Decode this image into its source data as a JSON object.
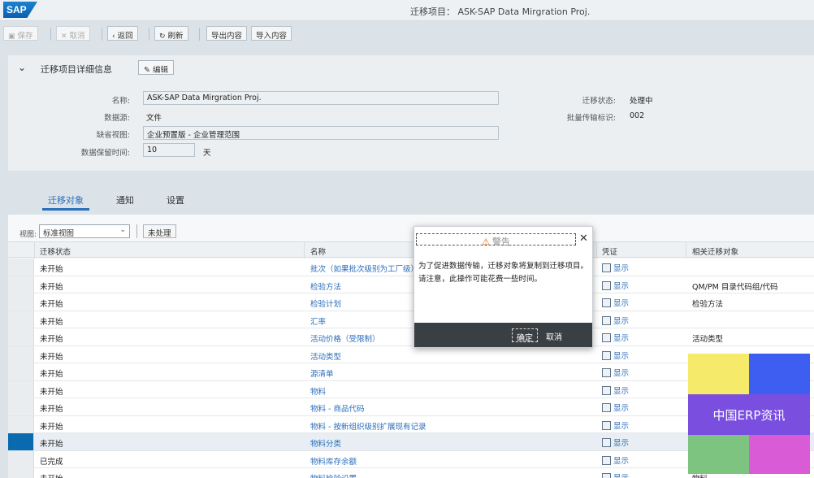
{
  "header": {
    "logo": "SAP",
    "title": "迁移项目：   ASK-SAP Data Mirgration Proj."
  },
  "toolbar": {
    "save": "保存",
    "cancel": "取消",
    "back": "返回",
    "refresh": "刷新",
    "export": "导出内容",
    "import": "导入内容"
  },
  "details": {
    "title": "迁移项目详细信息",
    "edit": "编辑",
    "name_label": "名称:",
    "name_value": "ASK-SAP Data Mirgration Proj.",
    "source_label": "数据源:",
    "source_value": "文件",
    "view_label": "缺省视图:",
    "view_value": "企业预置版 - 企业管理范围",
    "retention_label": "数据保留时间:",
    "retention_value": "10",
    "retention_unit": "天",
    "status_label": "迁移状态:",
    "status_value": "处理中",
    "batch_label": "批量传输标识:",
    "batch_value": "002"
  },
  "tabs": [
    {
      "label": "迁移对象"
    },
    {
      "label": "通知"
    },
    {
      "label": "设置"
    }
  ],
  "table": {
    "view_label": "视图:",
    "view_selected": "标准视图",
    "unprocessed": "未处理",
    "columns": [
      "迁移状态",
      "名称",
      "凭证",
      "相关迁移对象"
    ],
    "rows": [
      {
        "status": "未开始",
        "name": "批次（如果批次级别为工厂级）",
        "doc": "显示",
        "rel": ""
      },
      {
        "status": "未开始",
        "name": "检验方法",
        "doc": "显示",
        "rel": "QM/PM 目录代码组/代码"
      },
      {
        "status": "未开始",
        "name": "检验计划",
        "doc": "显示",
        "rel": "检验方法"
      },
      {
        "status": "未开始",
        "name": "汇率",
        "doc": "显示",
        "rel": ""
      },
      {
        "status": "未开始",
        "name": "活动价格（受限制）",
        "doc": "显示",
        "rel": "活动类型"
      },
      {
        "status": "未开始",
        "name": "活动类型",
        "doc": "显示",
        "rel": ""
      },
      {
        "status": "未开始",
        "name": "源清单",
        "doc": "显示",
        "rel": ""
      },
      {
        "status": "未开始",
        "name": "物料",
        "doc": "显示",
        "rel": ""
      },
      {
        "status": "未开始",
        "name": "物料 - 商品代码",
        "doc": "显示",
        "rel": ""
      },
      {
        "status": "未开始",
        "name": "物料 - 按新组织级别扩展现有记录",
        "doc": "显示",
        "rel": ""
      },
      {
        "status": "未开始",
        "name": "物料分类",
        "doc": "显示",
        "rel": ""
      },
      {
        "status": "已完成",
        "name": "物料库存余额",
        "doc": "显示",
        "rel": ""
      },
      {
        "status": "未开始",
        "name": "物料检验设置",
        "doc": "显示",
        "rel": "物料"
      }
    ]
  },
  "dialog": {
    "title": "警告",
    "body1": "为了促进数据传输，迁移对象将复制到迁移项目。",
    "body2": "请注意，此操作可能花费一些时间。",
    "ok": "确定",
    "cancel": "取消"
  },
  "watermark": {
    "text": "中国ERP资讯",
    "colors": [
      "#f5ea6a",
      "#3d5ef0",
      "#7a4fe0",
      "#7cc47f",
      "#d95bd6"
    ]
  }
}
